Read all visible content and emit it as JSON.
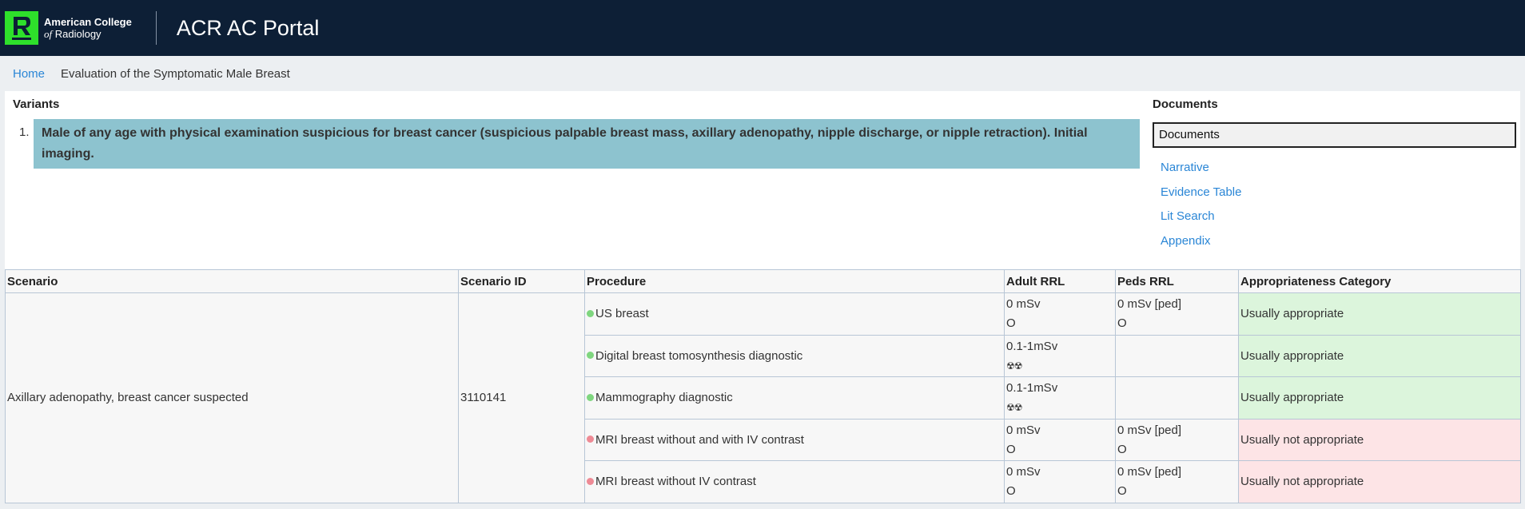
{
  "header": {
    "logo_line1": "American College",
    "logo_line2_of": "of",
    "logo_line2_rest": " Radiology",
    "portal_title": "ACR AC Portal"
  },
  "breadcrumb": {
    "home": "Home",
    "current": "Evaluation of the Symptomatic Male Breast"
  },
  "variants": {
    "title": "Variants",
    "items": [
      {
        "number": "1.",
        "text": "Male of any age with physical examination suspicious for breast cancer (suspicious palpable breast mass, axillary adenopathy, nipple discharge, or nipple retraction). Initial imaging."
      }
    ]
  },
  "documents": {
    "title": "Documents",
    "selected": "Documents",
    "links": [
      "Narrative",
      "Evidence Table",
      "Lit Search",
      "Appendix"
    ]
  },
  "table": {
    "headers": [
      "Scenario",
      "Scenario ID",
      "Procedure",
      "Adult RRL",
      "Peds RRL",
      "Appropriateness Category"
    ],
    "scenario": "Axillary adenopathy, breast cancer suspected",
    "scenario_id": "3110141",
    "rows": [
      {
        "procedure": "US breast",
        "adult_dose": "0 mSv",
        "adult_symbol": "O",
        "peds_dose": "0 mSv [ped]",
        "peds_symbol": "O",
        "category": "Usually appropriate",
        "dot_color": "#7fd67f",
        "cat_bg": "#dcf5dc"
      },
      {
        "procedure": "Digital breast tomosynthesis diagnostic",
        "adult_dose": "0.1-1mSv",
        "adult_symbol": "☢☢",
        "peds_dose": "",
        "peds_symbol": "",
        "category": "Usually appropriate",
        "dot_color": "#7fd67f",
        "cat_bg": "#dcf5dc"
      },
      {
        "procedure": "Mammography diagnostic",
        "adult_dose": "0.1-1mSv",
        "adult_symbol": "☢☢",
        "peds_dose": "",
        "peds_symbol": "",
        "category": "Usually appropriate",
        "dot_color": "#7fd67f",
        "cat_bg": "#dcf5dc"
      },
      {
        "procedure": "MRI breast without and with IV contrast",
        "adult_dose": "0 mSv",
        "adult_symbol": "O",
        "peds_dose": "0 mSv [ped]",
        "peds_symbol": "O",
        "category": "Usually not appropriate",
        "dot_color": "#ee8a95",
        "cat_bg": "#fde4e6"
      },
      {
        "procedure": "MRI breast without IV contrast",
        "adult_dose": "0 mSv",
        "adult_symbol": "O",
        "peds_dose": "0 mSv [ped]",
        "peds_symbol": "O",
        "category": "Usually not appropriate",
        "dot_color": "#ee8a95",
        "cat_bg": "#fde4e6"
      }
    ]
  }
}
